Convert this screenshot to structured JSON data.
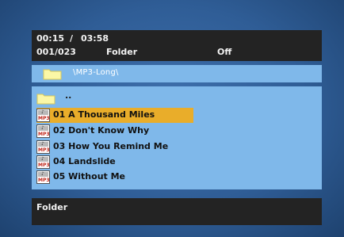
{
  "status": {
    "elapsed_time": "00:15",
    "separator": "/",
    "total_time": "03:58",
    "track_counter": "001/023",
    "mode": "Folder",
    "repeat": "Off"
  },
  "path": {
    "current": "\\MP3-Long\\"
  },
  "file_list": {
    "parent_label": "..",
    "tracks": [
      {
        "label": "01  A  Thousand  Miles",
        "selected": true
      },
      {
        "label": "02  Don't  Know  Why",
        "selected": false
      },
      {
        "label": "03  How  You  Remind  Me",
        "selected": false
      },
      {
        "label": "04  Landslide",
        "selected": false
      },
      {
        "label": "05  Without  Me",
        "selected": false
      }
    ],
    "icon_text": "MP3"
  },
  "info": {
    "label": "Folder"
  },
  "colors": {
    "background": "#2f5d96",
    "list_bg": "#7fb8ea",
    "highlight": "#e9ad2a",
    "panel_dark": "#232323"
  },
  "icons": {
    "folder": "folder-icon",
    "audio_file": "mp3-file-icon"
  }
}
